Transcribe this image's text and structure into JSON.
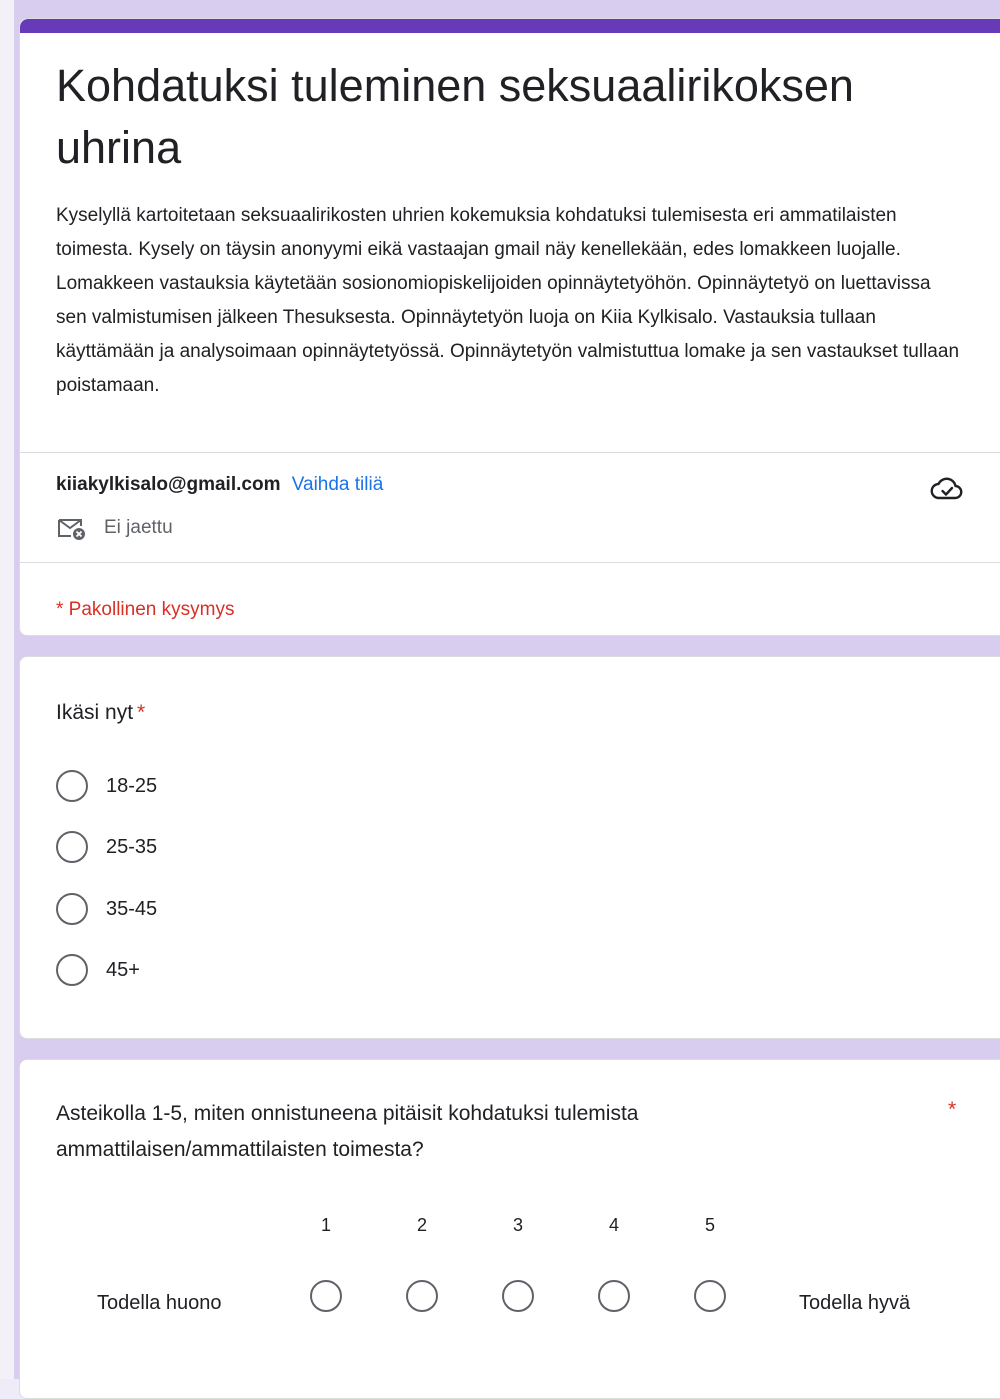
{
  "form": {
    "title": "Kohdatuksi tuleminen seksuaalirikoksen uhrina",
    "description": "Kyselyllä kartoitetaan seksuaalirikosten uhrien kokemuksia kohdatuksi tulemisesta eri ammatilaisten toimesta. Kysely on täysin anonyymi eikä vastaajan gmail näy kenellekään, edes lomakkeen luojalle. Lomakkeen vastauksia käytetään sosionomiopiskelijoiden opinnäytetyöhön. Opinnäytetyö on luettavissa sen valmistumisen jälkeen Thesuksesta. Opinnäytetyön luoja on Kiia Kylkisalo. Vastauksia tullaan käyttämään ja analysoimaan opinnäytetyössä. Opinnäytetyön valmistuttua lomake ja sen vastaukset tullaan poistamaan.",
    "account_email": "kiiakylkisalo@gmail.com",
    "switch_account": "Vaihda tiliä",
    "not_shared": "Ei jaettu",
    "required_note": "* Pakollinen kysymys"
  },
  "question1": {
    "title": "Ikäsi nyt",
    "required_mark": "*",
    "options": [
      "18-25",
      "25-35",
      "35-45",
      "45+"
    ]
  },
  "question2": {
    "title": "Asteikolla 1-5, miten onnistuneena pitäisit kohdatuksi tulemista ammattilaisen/ammattilaisten toimesta?",
    "required_mark": "*",
    "scale": [
      "1",
      "2",
      "3",
      "4",
      "5"
    ],
    "low_label": "Todella huono",
    "high_label": "Todella hyvä"
  },
  "colors": {
    "accent": "#673ab7",
    "background": "#d9cdef",
    "required": "#d93025",
    "link": "#1a73e8"
  },
  "icons": {
    "cloud": "cloud-check-icon",
    "mail": "mail-off-icon"
  }
}
